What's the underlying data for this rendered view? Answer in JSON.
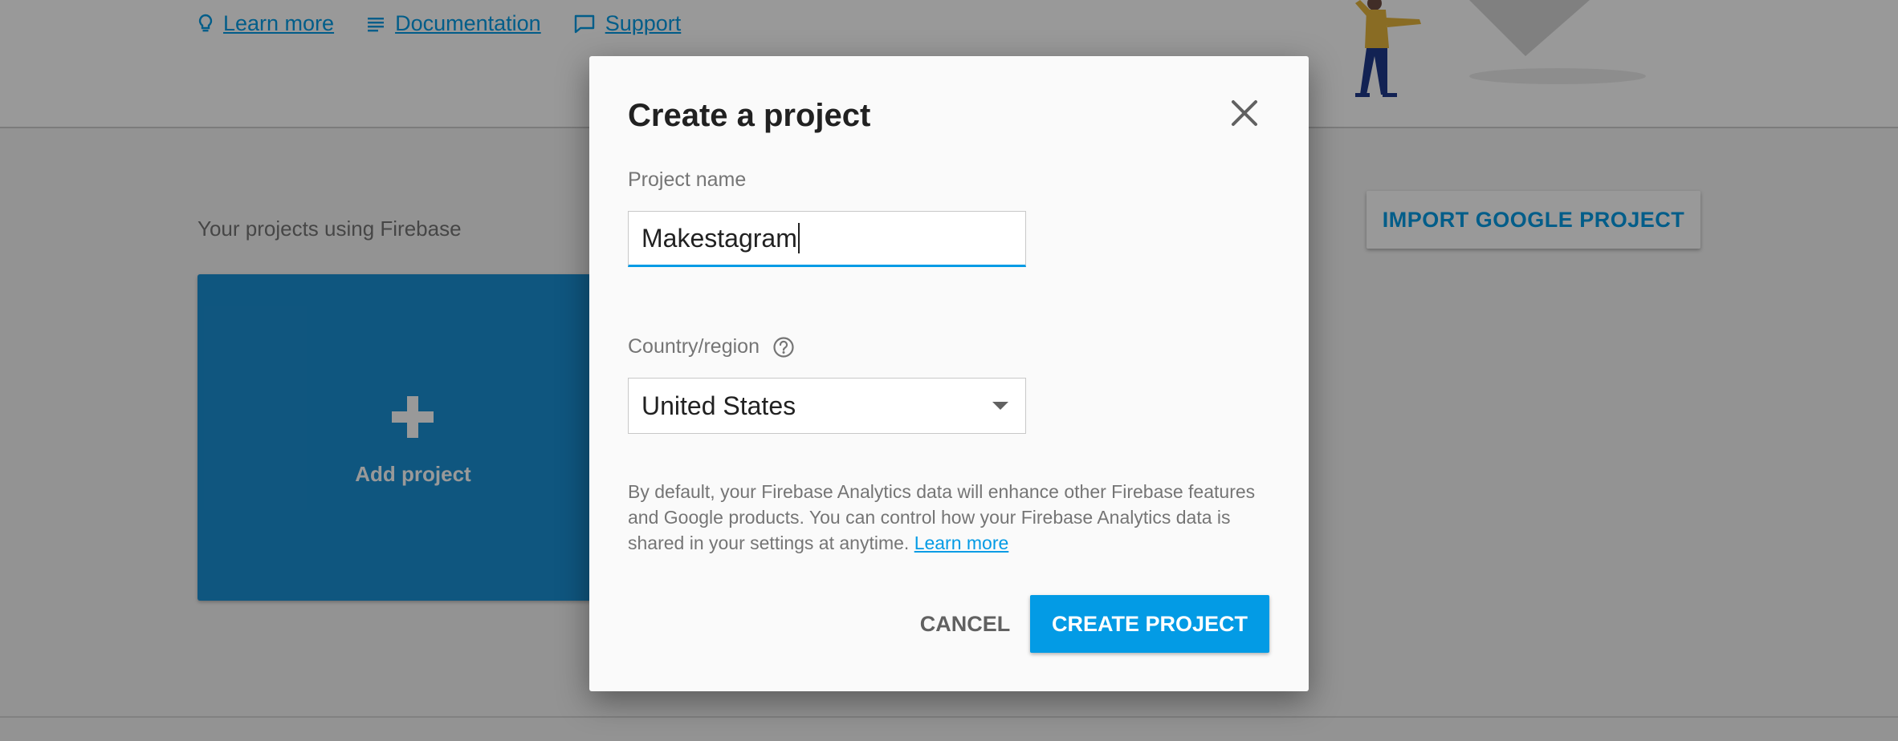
{
  "header": {
    "links": [
      {
        "label": "Learn more",
        "icon": "lightbulb-icon"
      },
      {
        "label": "Documentation",
        "icon": "notes-icon"
      },
      {
        "label": "Support",
        "icon": "chat-bubble-icon"
      }
    ]
  },
  "main": {
    "projects_heading": "Your projects using Firebase",
    "add_project_label": "Add project",
    "import_button_label": "IMPORT GOOGLE PROJECT"
  },
  "dialog": {
    "title": "Create a project",
    "project_name_label": "Project name",
    "project_name_value": "Makestagram",
    "country_label": "Country/region",
    "country_value": "United States",
    "disclaimer_text": "By default, your Firebase Analytics data will enhance other Firebase features and Google products. You can control how your Firebase Analytics data is shared in your settings at anytime.",
    "disclaimer_link": "Learn more",
    "cancel_label": "CANCEL",
    "create_label": "CREATE PROJECT"
  },
  "colors": {
    "accent": "#039be5",
    "card": "#1a8fd4",
    "text_primary": "#212121",
    "text_secondary": "#757575"
  }
}
